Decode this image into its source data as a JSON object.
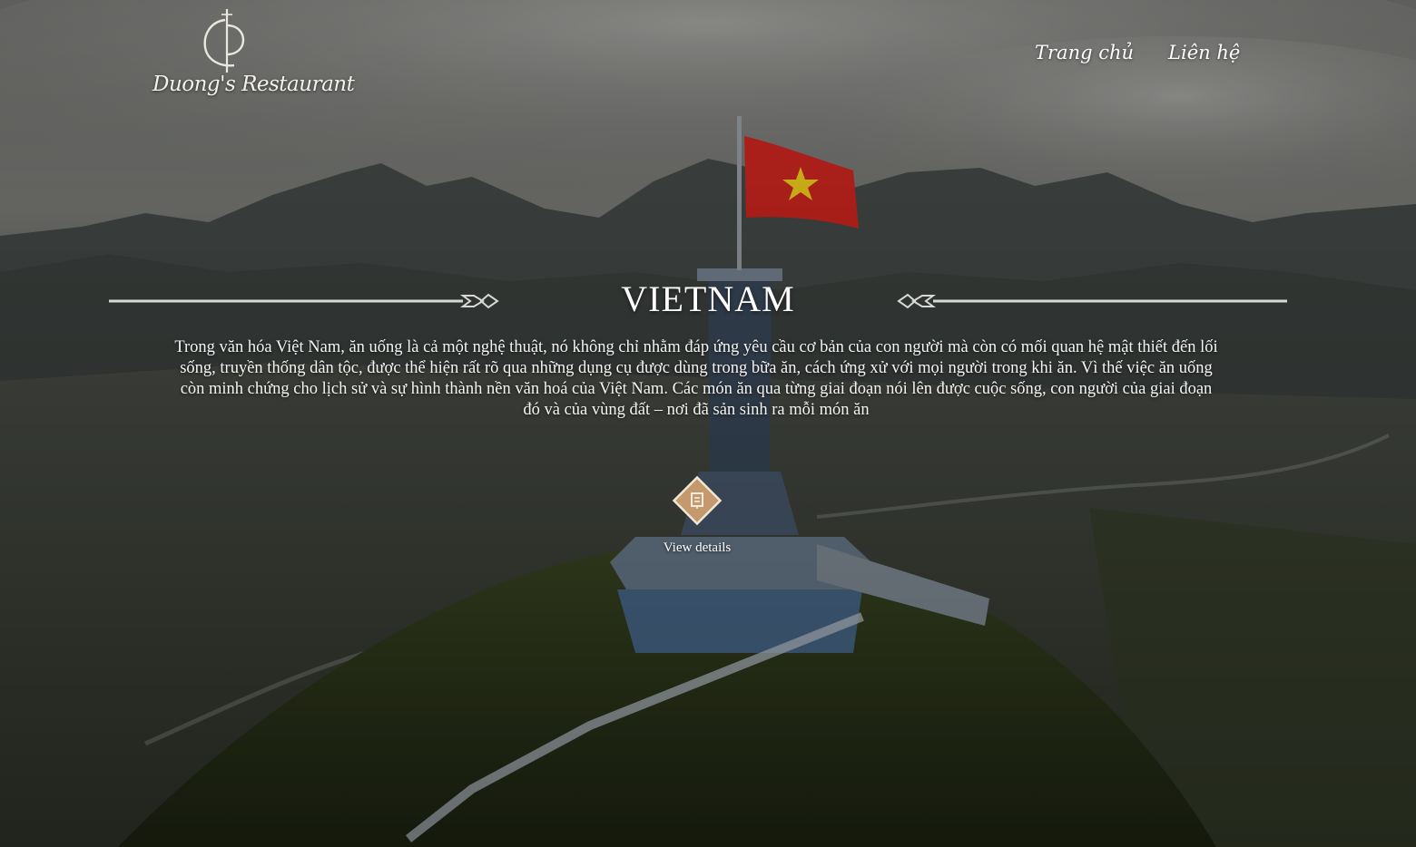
{
  "brand": {
    "name": "Duong's Restaurant"
  },
  "nav": {
    "home": "Trang chủ",
    "contact": "Liên hệ"
  },
  "hero": {
    "title": "VIETNAM",
    "description": "Trong văn hóa Việt Nam, ăn uống là cả một nghệ thuật, nó không chỉ nhằm đáp ứng yêu cầu cơ bản của con người mà còn có mối quan hệ mật thiết đến lối sống, truyền thống dân tộc, được thể hiện rất rõ qua những dụng cụ được dùng trong bữa ăn, cách ứng xử với mọi người trong khi ăn. Vì thế việc ăn uống còn minh chứng cho lịch sử và sự hình thành nền văn hoá của Việt Nam. Các món ăn qua từng giai đoạn nói lên được cuộc sống, con người của giai đoạn đó và của vùng đất – nơi đã sản sinh ra mỗi món ăn",
    "details_label": "View details",
    "details_icon": "document-icon"
  },
  "colors": {
    "accent_gold": "#c49a6c",
    "flag_red": "#d1261f",
    "flag_star": "#f6d21c"
  }
}
